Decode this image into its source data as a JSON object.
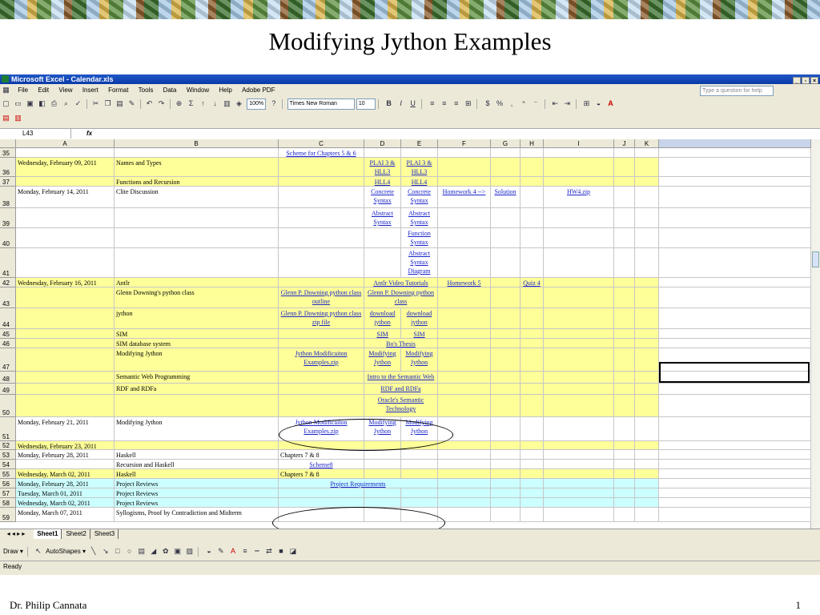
{
  "slide": {
    "title": "Modifying Jython Examples",
    "footer_left": "Dr. Philip Cannata",
    "footer_right": "1"
  },
  "excel": {
    "window_title": "Microsoft Excel - Calendar.xls",
    "menu": [
      "File",
      "Edit",
      "View",
      "Insert",
      "Format",
      "Tools",
      "Data",
      "Window",
      "Help",
      "Adobe PDF"
    ],
    "ask_placeholder": "Type a question for help",
    "zoom": "100%",
    "font_name": "Times New Roman",
    "font_size": "10",
    "name_box": "L43",
    "fx": "fx",
    "columns": [
      "A",
      "B",
      "C",
      "D",
      "E",
      "F",
      "G",
      "H",
      "I",
      "J",
      "K"
    ],
    "sheet_tabs": [
      "Sheet1",
      "Sheet2",
      "Sheet3"
    ],
    "draw_label": "Draw",
    "autoshapes_label": "AutoShapes",
    "status": "Ready",
    "colors": {
      "yellow": "#ffff99",
      "cyan": "#ccffff",
      "white": "#ffffff",
      "link": "#1a24c8"
    },
    "rows": [
      {
        "num": "35",
        "bg": "white",
        "cells": {
          "C": "Scheme for Chapters 5 & 6"
        }
      },
      {
        "num": "36",
        "bg": "yellow",
        "cells": {
          "A": "Wednesday, February 09, 2011",
          "B": "Names and Types",
          "D": "PLAI 3 & HLL3",
          "E": "PLAI 3 & HLL3"
        }
      },
      {
        "num": "37",
        "bg": "yellow",
        "cells": {
          "B": "Functions and Recursion",
          "D": "HLL4",
          "E": "HLL4"
        }
      },
      {
        "num": "38",
        "bg": "white",
        "cells": {
          "A": "Monday, February 14, 2011",
          "B": "Clite Discussion",
          "D": "Concrete Syntax",
          "E": "Concrete Syntax",
          "F": "Homework 4 -->",
          "G": "Solution",
          "I": "HW4.zip"
        }
      },
      {
        "num": "39",
        "bg": "white",
        "cells": {
          "D": "Abstract Syntax",
          "E": "Abstract Syntax"
        }
      },
      {
        "num": "40",
        "bg": "white",
        "cells": {
          "E": "Function Syntax"
        }
      },
      {
        "num": "41",
        "bg": "white",
        "cells": {
          "E": "Abstract Syntax Diagram"
        }
      },
      {
        "num": "42",
        "bg": "yellow",
        "cells": {
          "A": "Wednesday, February 16, 2011",
          "B": "Antlr",
          "DE": "Antlr Video Tutorials",
          "F": "Homework 5",
          "H": "Quiz 4"
        }
      },
      {
        "num": "43",
        "bg": "yellow",
        "cells": {
          "B": "Glenn Downing's python class",
          "C": "Glenn P. Downing python class outline",
          "DE": "Glenn P. Downing python class"
        }
      },
      {
        "num": "44",
        "bg": "yellow",
        "cells": {
          "B": "jython",
          "C": "Glenn P. Downing python class zip file",
          "D": "download jython",
          "E": "download jython"
        }
      },
      {
        "num": "45",
        "bg": "yellow",
        "cells": {
          "B": "SIM",
          "D": "SIM",
          "E": "SIM"
        }
      },
      {
        "num": "46",
        "bg": "yellow",
        "cells": {
          "B": "SIM database system",
          "DE": "Bo's Thesis"
        }
      },
      {
        "num": "47",
        "bg": "yellow",
        "cells": {
          "B": "Modifying Jython",
          "C": "Jython Modificaiton Examples.zip",
          "D": "Modifying Jython",
          "E": "Modifying Jython"
        }
      },
      {
        "num": "48",
        "bg": "yellow",
        "cells": {
          "B": "Semantic Web Programming",
          "DE": "Intro to the Semantic Web"
        }
      },
      {
        "num": "49",
        "bg": "yellow",
        "cells": {
          "B": "RDF and RDFa",
          "DE": "RDF and RDFa"
        }
      },
      {
        "num": "50",
        "bg": "yellow",
        "cells": {
          "DE": "Oracle's Semantic Technology"
        }
      },
      {
        "num": "51",
        "bg": "white",
        "cells": {
          "A": "Monday, February 21, 2011",
          "B": "Modifying Jython",
          "C": "Jython Modificaiton Examples.zip",
          "D": "Modifying Jython",
          "E": "Modifying Jython"
        }
      },
      {
        "num": "52",
        "bg": "yellow",
        "cells": {
          "A": "Wednesday, February 23, 2011"
        }
      },
      {
        "num": "53",
        "bg": "white",
        "cells": {
          "A": "Monday, February 28, 2011",
          "B": "Haskell",
          "C": "Chapters 7 & 8"
        }
      },
      {
        "num": "54",
        "bg": "white",
        "cells": {
          "B": "Recursion and Haskell",
          "C": "Scheme8"
        }
      },
      {
        "num": "55",
        "bg": "yellow",
        "cells": {
          "A": "Wednesday, March 02, 2011",
          "B": "Haskell",
          "C": "Chapters 7 & 8"
        }
      },
      {
        "num": "56",
        "bg": "cyan",
        "cells": {
          "A": "Monday, February 28, 2011",
          "B": "Project Reviews",
          "CE": "Project Requirements"
        }
      },
      {
        "num": "57",
        "bg": "cyan",
        "cells": {
          "A": "Tuesday, March 01, 2011",
          "B": "Project Reviews"
        }
      },
      {
        "num": "58",
        "bg": "cyan",
        "cells": {
          "A": "Wednesday, March 02, 2011",
          "B": "Project Reviews"
        }
      },
      {
        "num": "59",
        "bg": "white",
        "cells": {
          "A": "Monday, March 07, 2011",
          "B": "Syllogisms, Proof by Contradiction and Midterm"
        }
      }
    ]
  }
}
